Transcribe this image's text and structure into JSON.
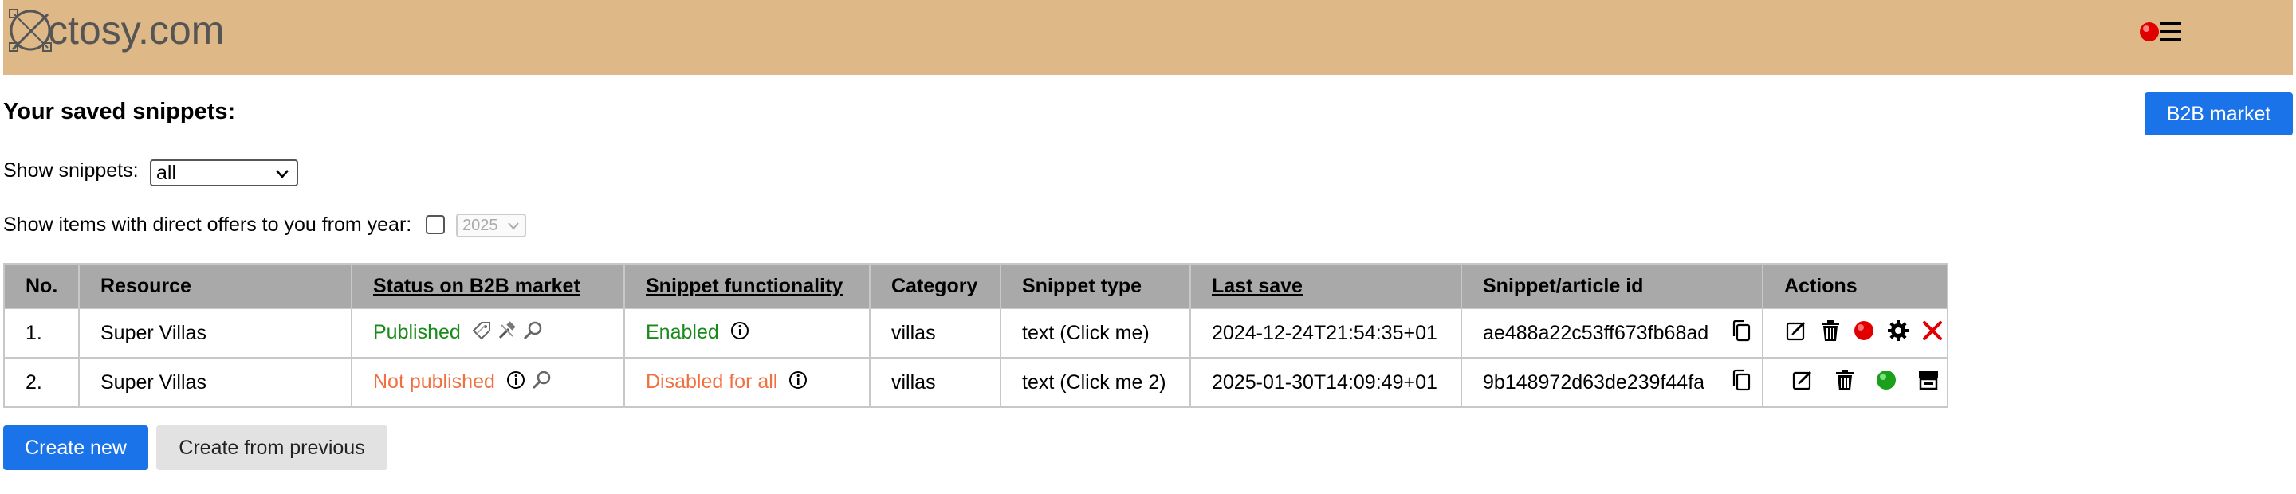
{
  "header": {
    "logo_text": "ctosy.com",
    "logo_icon": "compass-logo-icon",
    "menu_icon": "hamburger-menu-icon",
    "status_dot_color": "#e00000"
  },
  "page": {
    "title": "Your saved snippets:",
    "b2b_button": "B2B market"
  },
  "filters": {
    "show_snippets_label": "Show snippets:",
    "show_snippets_value": "all",
    "offers_label": "Show items with direct offers to you from year:",
    "offers_checked": false,
    "year_value": "2025"
  },
  "table": {
    "headers": {
      "no": "No.",
      "resource": "Resource",
      "status": "Status on B2B market",
      "functionality": "Snippet functionality",
      "category": "Category",
      "type": "Snippet type",
      "last_save": "Last save",
      "id": "Snippet/article id",
      "actions": "Actions"
    },
    "rows": [
      {
        "no": "1.",
        "resource": "Super Villas",
        "status": "Published",
        "functionality": "Enabled",
        "category": "villas",
        "type": "text (Click me)",
        "last_save": "2024-12-24T21:54:35+01",
        "id": "ae488a22c53ff673fb68ad"
      },
      {
        "no": "2.",
        "resource": "Super Villas",
        "status": "Not published",
        "functionality": "Disabled for all",
        "category": "villas",
        "type": "text (Click me 2)",
        "last_save": "2025-01-30T14:09:49+01",
        "id": "9b148972d63de239f44fa"
      }
    ]
  },
  "buttons": {
    "create_new": "Create new",
    "create_from_previous": "Create from previous"
  },
  "colors": {
    "header_bg": "#deb887",
    "primary": "#1a73e8",
    "published": "#1a8a1a",
    "not_published": "#f07040"
  }
}
